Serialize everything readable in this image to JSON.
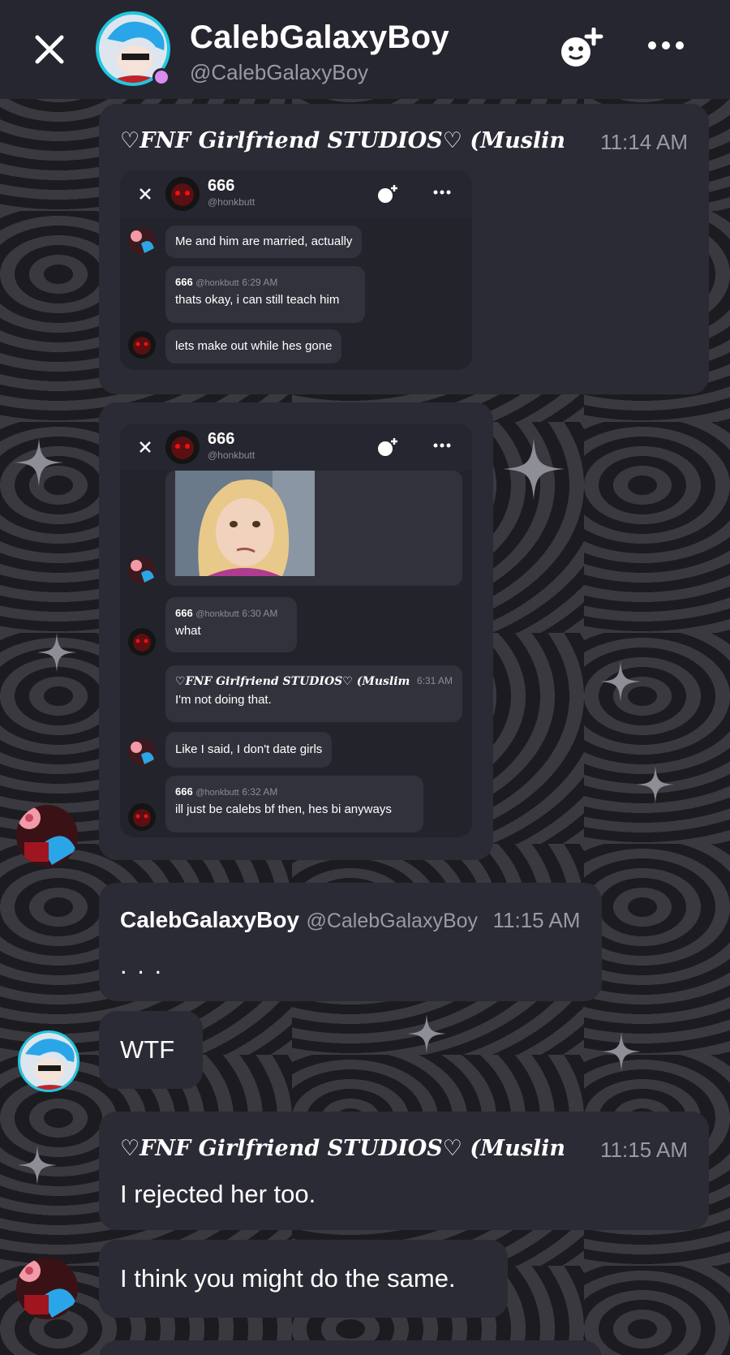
{
  "header": {
    "name": "CalebGalaxyBoy",
    "handle": "@CalebGalaxyBoy"
  },
  "colors": {
    "header_bg": "#262630",
    "card_bg": "#2b2b35",
    "bubble_bg": "#32323d",
    "muted_text": "#9a9aa4",
    "avatar_accent": "#1ec8e0",
    "status_dot": "#d98cf0"
  },
  "messages": [
    {
      "author": "♡FNF Girlfriend STUDIOS♡ (Muslin",
      "time": "11:14 AM",
      "screenshot": {
        "chat_name": "666",
        "chat_handle": "@honkbutt",
        "items": [
          {
            "text": "Me and him are married, actually"
          },
          {
            "author": "666",
            "handle": "@honkbutt",
            "time": "6:29 AM",
            "text": "thats okay, i can still teach him"
          },
          {
            "text": "lets make out while hes gone"
          }
        ]
      }
    },
    {
      "screenshot": {
        "chat_name": "666",
        "chat_handle": "@honkbutt",
        "items": [
          {
            "author": "666",
            "handle": "@honkbutt",
            "time": "6:30 AM",
            "text": "what"
          },
          {
            "author": "♡FNF Girlfriend STUDIOS♡ (Muslim",
            "time": "6:31 AM",
            "text": "I'm not doing that."
          },
          {
            "text": "Like I said, I don't date girls"
          },
          {
            "author": "666",
            "handle": "@honkbutt",
            "time": "6:32 AM",
            "text": "ill just be calebs bf then, hes bi anyways"
          }
        ]
      }
    },
    {
      "author": "CalebGalaxyBoy",
      "handle": "@CalebGalaxyBoy",
      "time": "11:15 AM",
      "text": ". . ."
    },
    {
      "text": "WTF"
    },
    {
      "author": "♡FNF Girlfriend STUDIOS♡ (Muslin",
      "time": "11:15 AM",
      "text": "I rejected her too."
    },
    {
      "text": "I think you might do the same."
    }
  ]
}
